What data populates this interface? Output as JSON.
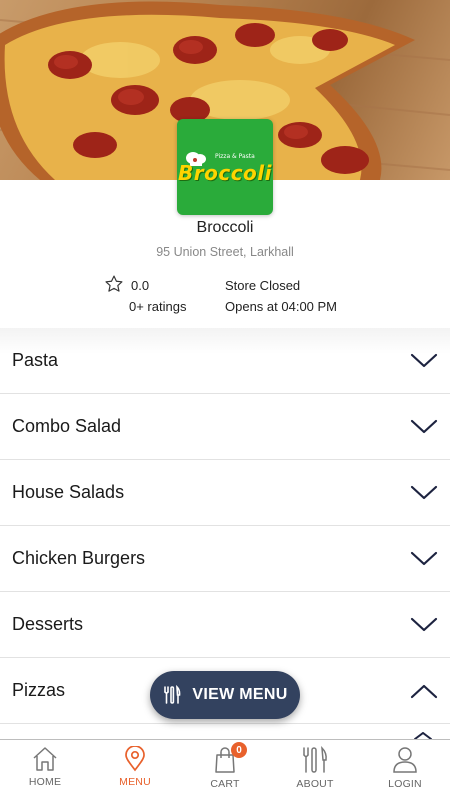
{
  "store": {
    "name": "Broccoli",
    "address": "95 Union Street, Larkhall",
    "logo_text": "Broccoli",
    "logo_subtext": "Pizza & Pasta",
    "rating": "0.0",
    "ratings_count": "0+ ratings",
    "status": "Store Closed",
    "opens": "Opens at 04:00 PM"
  },
  "menu": {
    "categories": [
      {
        "label": "Pasta",
        "expanded": false
      },
      {
        "label": "Combo Salad",
        "expanded": false
      },
      {
        "label": "House Salads",
        "expanded": false
      },
      {
        "label": "Chicken Burgers",
        "expanded": false
      },
      {
        "label": "Desserts",
        "expanded": false
      },
      {
        "label": "Pizzas",
        "expanded": true
      }
    ]
  },
  "view_menu": {
    "label": "VIEW MENU",
    "icon": "cutlery-icon"
  },
  "tabbar": {
    "items": [
      {
        "label": "HOME",
        "icon": "home-icon"
      },
      {
        "label": "MENU",
        "icon": "location-pin-icon",
        "active": true
      },
      {
        "label": "CART",
        "icon": "shopping-bag-icon",
        "badge": "0"
      },
      {
        "label": "ABOUT",
        "icon": "cutlery-icon"
      },
      {
        "label": "LOGIN",
        "icon": "user-icon"
      }
    ]
  },
  "colors": {
    "accent": "#e8612c",
    "button": "#33425f",
    "logo_bg": "#2aab3a",
    "logo_text": "#ffd400",
    "chevron": "#1d2340"
  }
}
